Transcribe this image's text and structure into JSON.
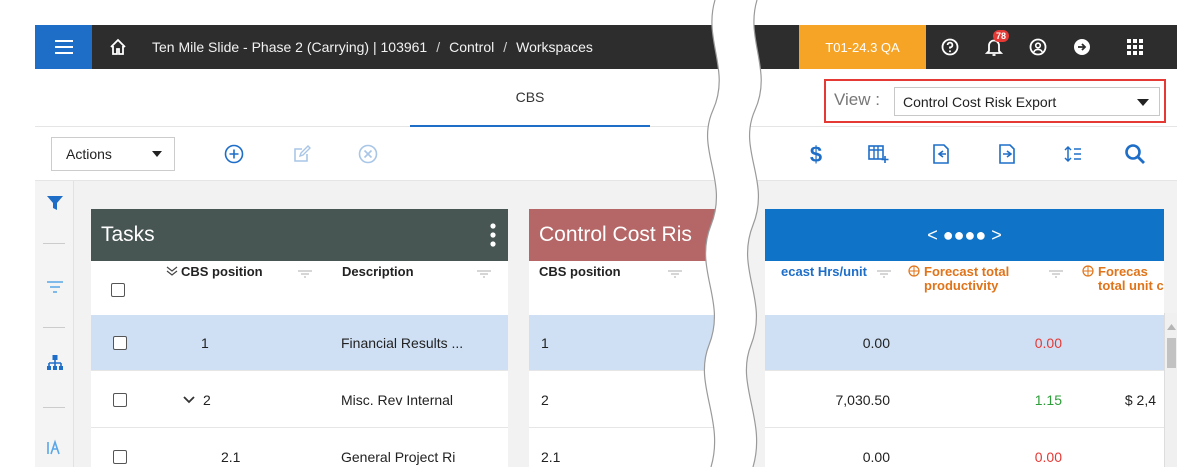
{
  "header": {
    "breadcrumb": [
      "Ten Mile Slide - Phase 2 (Carrying) | 103961",
      "Control",
      "Workspaces"
    ],
    "breadcrumb_sep": "/",
    "environment": "T01-24.3 QA",
    "notifications_count": "78"
  },
  "tabs": {
    "active": "CBS"
  },
  "view": {
    "label": "View :",
    "selected": "Control Cost Risk Export"
  },
  "toolbar": {
    "actions_label": "Actions"
  },
  "tasks_panel": {
    "title": "Tasks",
    "columns": [
      "CBS position",
      "Description"
    ],
    "rows": [
      {
        "cbs": "1",
        "desc": "Financial Results ..."
      },
      {
        "cbs": "2",
        "desc": "Misc. Rev Internal"
      },
      {
        "cbs": "2.1",
        "desc": "General Project Ri"
      }
    ]
  },
  "control_panel": {
    "title": "Control Cost Ris",
    "columns": [
      "CBS position"
    ],
    "rows": [
      "1",
      "2",
      "2.1"
    ]
  },
  "blue_panel": {
    "pager": "< ●●●● >",
    "columns": [
      "ecast Hrs/unit",
      "Forecast total productivity",
      "Forecas total unit c"
    ],
    "rows": [
      {
        "a": "0.00",
        "b": "0.00",
        "b_color": "#e53935",
        "c": ""
      },
      {
        "a": "7,030.50",
        "b": "1.15",
        "b_color": "#2e9e3a",
        "c": "$ 2,4"
      },
      {
        "a": "0.00",
        "b": "0.00",
        "b_color": "#e53935",
        "c": ""
      }
    ]
  },
  "colors": {
    "topbar": "#2d2d2d",
    "accent": "#1e6ec8",
    "env": "#f6a425",
    "tasks_head": "#475553",
    "control_head": "#b56767",
    "blue_head": "#0f74c7",
    "highlight": "#e53935",
    "selected_row": "#cfe0f4"
  },
  "icons": {
    "menu": "hamburger-icon",
    "home": "home-icon",
    "help": "help-circle-icon",
    "bell": "bell-icon",
    "user": "user-circle-icon",
    "logout": "logout-icon",
    "apps": "grid-apps-icon",
    "add": "add-circle-icon",
    "edit": "edit-icon",
    "delete": "delete-circle-icon",
    "dollar": "dollar-icon",
    "columns": "add-column-icon",
    "import": "import-icon",
    "export": "export-icon",
    "sort": "sort-icon",
    "search": "search-icon",
    "filter": "filter-icon",
    "filter_lines": "filter-lines-icon",
    "hierarchy": "hierarchy-icon"
  }
}
